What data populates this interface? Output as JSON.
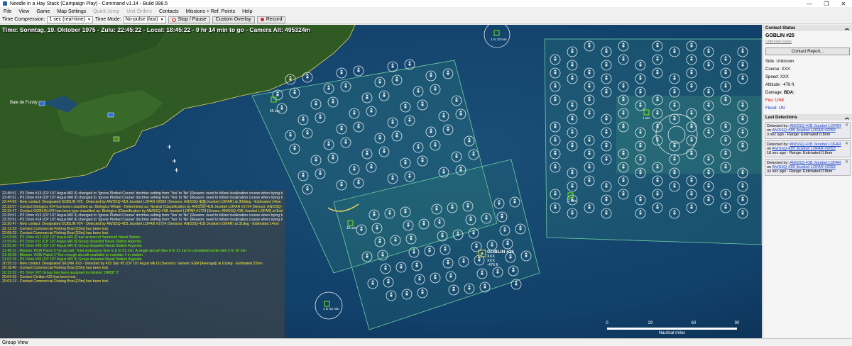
{
  "window": {
    "title": "Needle in a Hay Stack (Campaign Play) - Command v1.14 - Build 998.5",
    "controls": [
      "—",
      "❐",
      "✕"
    ]
  },
  "menu": {
    "items": [
      {
        "label": "File",
        "enabled": true
      },
      {
        "label": "View",
        "enabled": true
      },
      {
        "label": "Game",
        "enabled": true
      },
      {
        "label": "Map Settings",
        "enabled": true
      },
      {
        "label": "Quick Jump",
        "enabled": false
      },
      {
        "label": "Unit Orders",
        "enabled": false
      },
      {
        "label": "Contacts",
        "enabled": true
      },
      {
        "label": "Missions + Ref. Points",
        "enabled": true
      },
      {
        "label": "Help",
        "enabled": true
      }
    ]
  },
  "toolbar": {
    "time_compression_label": "Time Compression:",
    "time_compression_value": "1 sec (real-time)",
    "time_mode_label": "Time Mode:",
    "time_mode_value": "No-pulse (fast)",
    "stop_pause_label": "Stop / Pause",
    "custom_overlay_label": "Custom Overlay",
    "record_label": "Record"
  },
  "map": {
    "time_line": "Time: Sonntag, 19. Oktober 1975 - Zulu: 22:45:22 - Local: 18:45:22 - 9 hr 14 min to go -  Camera Alt: 495324m",
    "place_label": "Baie de Fundy",
    "unit_labels": {
      "top": "1 hr 33 min",
      "a": "55 sec",
      "b": "18 sec",
      "c": "2 sec",
      "d": "1 sec",
      "bottom": "1 hr 52 min"
    },
    "selected_contact": {
      "name": "GOBLIN #25",
      "course": "XXX",
      "speed": "XXX",
      "altitude": "-476 ft"
    },
    "scale": {
      "ticks": [
        "0",
        "29",
        "60",
        "90"
      ],
      "unit": "Nautical miles"
    }
  },
  "log": {
    "lines": [
      {
        "text": "22:45:51 - P3 Orion #13 (CP 107 Argus MR II) changed to 'Ignore Plotted Course' doctrine setting from 'Yes' to 'No' (Reason: need to follow localization course when trying to regain contact)",
        "color": "#f2f2f2"
      },
      {
        "text": "22:45:51 - P3 Orion #14 (CP 107 Argus MR II) changed to 'Ignore Plotted Course' doctrine setting from 'Yes' to 'No' (Reason: need to follow localization course when trying to regain contact)",
        "color": "#f2f2f2"
      },
      {
        "text": "22:44:59 - New contact: Designated GOBLIN #25 - Detected by AN/SSQ-41B Jezebel LOFAR #2059 (Sensors: AN/SSQ-41B Jezebel LOFAR) at 303deg - Estimated 14nm",
        "color": "#ffeb3b"
      },
      {
        "text": "22:33:57 - Contact Biologics #24 has been classified as: Biologics Whale - Determined as: Neutral (Classification by AN/SSQ-41B Jezebel LOFAR #1724 [Sensor: AN/SSQ-41B Jezebel LOFAR] at Estimated 0.8nm)",
        "color": "#ffeb3b"
      },
      {
        "text": "22:32:47 - Contact GOBLIN #24 has been type-classified as: Biologics (Classification by AN/SSQ-41B Jezebel LOFAR #1724 [Sensor: AN/SSQ-41B Jezebel LOFAR] at Estimated 0.8nm)",
        "color": "#ffeb3b"
      },
      {
        "text": "22:29:51 - P3 Orion #13 (CP 107 Argus MR II) changed to 'Ignore Plotted Course' doctrine setting from 'Yes' to 'No' (Reason: need to follow localization course when trying to regain contact)",
        "color": "#f2f2f2"
      },
      {
        "text": "22:29:51 - P3 Orion #14 (CP 107 Argus MR II) changed to 'Ignore Plotted Course' doctrine setting from 'Yes' to 'No' (Reason: need to follow localization course when trying to regain contact)",
        "color": "#f2f2f2"
      },
      {
        "text": "22:20:47 - New contact: Designated GOBLIN #24 - Detected by AN/SSQ-41B Jezebel LOFAR #1724 (Sensors: AN/SSQ-41B Jezebel LOFAR) at 31deg - Estimated 14nm",
        "color": "#ffeb3b"
      },
      {
        "text": "22:12:33 - Contact Commercial Fishing Boat [23m] has been lost.",
        "color": "#ffeb3b"
      },
      {
        "text": "22:08:33 - Contact Commercial Fishing Boat [23m] has been lost.",
        "color": "#ffeb3b"
      },
      {
        "text": "22:03:58 - P3 Orion #12 (CP 107 Argus MR II) has arrived at Yarmouth Naval Station.",
        "color": "#7cfc00"
      },
      {
        "text": "21:59:42 - P3 Orion #11 (CP 107 Argus MR II) Group departed Naval Station Argentia",
        "color": "#7cfc00"
      },
      {
        "text": "21:55:30 - P3 Orion #09 (CP 107 Argus MR II) Group departed Naval Station Argentia",
        "color": "#7cfc00"
      },
      {
        "text": "21:48:11 - Mission 'ASW Patrol 2' for aircraft: Total endurance time is 8 hr 51 min. A single aircraft flies 8 hr 21 min in completed sortie with 5 hr 30 min",
        "color": "#7cfc00"
      },
      {
        "text": "21:42:09 - Mission 'ASW Patrol 1' Not enough aircraft available to maintain 1 in station.",
        "color": "#7cfc00"
      },
      {
        "text": "21:02:15 - P3 Orion #03 (CP 107 Argus MR II) Group departed Naval Station Argentia",
        "color": "#7cfc00"
      },
      {
        "text": "20:25:13 - New contact: Designated SKUNK #23 - Detected by 415 Sqn #5 (CP 107 Argus Mk II) (Sensors: Generic ESM [Average]) at 61deg - Estimated 22nm",
        "color": "#ffeb3b"
      },
      {
        "text": "20:18:40 - Contact Commercial Fishing Boat [23m] has been lost.",
        "color": "#ffeb3b"
      },
      {
        "text": "20:15:32 - P3 Orion #07 Group has been assigned to mission 'ORBIT 2'",
        "color": "#7cfc00"
      },
      {
        "text": "20:04:33 - Contact Civilian #22 has been lost.",
        "color": "#ffeb3b"
      },
      {
        "text": "20:02:13 - Contact Commercial Fishing Boat [23m] has been lost.",
        "color": "#ffeb3b"
      }
    ]
  },
  "contact_status": {
    "header": "Contact Status",
    "name": "GOBLIN #25",
    "class_text": "Unknown class",
    "report_button": "Contact Report...",
    "side_label": "Side:",
    "side_value": "Unknown",
    "course_label": "Course:",
    "course_value": "XXX",
    "speed_label": "Speed:",
    "speed_value": "XXX",
    "altitude_label": "Altitude:",
    "altitude_value": "-476 ft",
    "damage_label": "Damage:",
    "damage_value": "BDA:",
    "fire_label": "Fire:",
    "fire_value": "UNK",
    "flood_label": "Flood:",
    "flood_value": "UN"
  },
  "last_detections": {
    "header": "Last Detections",
    "items": [
      {
        "prefix": "Detected by:",
        "sensor": "AN/SSQ-41B Jezebel LOFAR",
        "on_label": "on",
        "platform": "AN/SSQ-41B Jezebel LOFAR #2059",
        "detail": "3 sec ago - Range: Estimated 0.8nm"
      },
      {
        "prefix": "Detected by:",
        "sensor": "AN/SSQ-41B Jezebel LOFAR",
        "on_label": "on",
        "platform": "AN/SSQ-41B Jezebel LOFAR #2053",
        "detail": "18 sec ago - Range: Estimated 0.8nm"
      },
      {
        "prefix": "Detected by:",
        "sensor": "AN/SSQ-41B Jezebel LOFAR",
        "on_label": "on",
        "platform": "AN/SSQ-41B Jezebel LOFAR #2058",
        "detail": "33 sec ago - Range: Estimated 0.8nm"
      }
    ]
  },
  "status_bar": {
    "text": "Group View"
  },
  "colors": {
    "ocean": "#0f3a5f",
    "land": "#2f5a24",
    "zone": "#3fa37a",
    "sonobuoy": "#dfe8ef",
    "alert_red": "#d40000",
    "link_blue": "#1b46c8"
  }
}
